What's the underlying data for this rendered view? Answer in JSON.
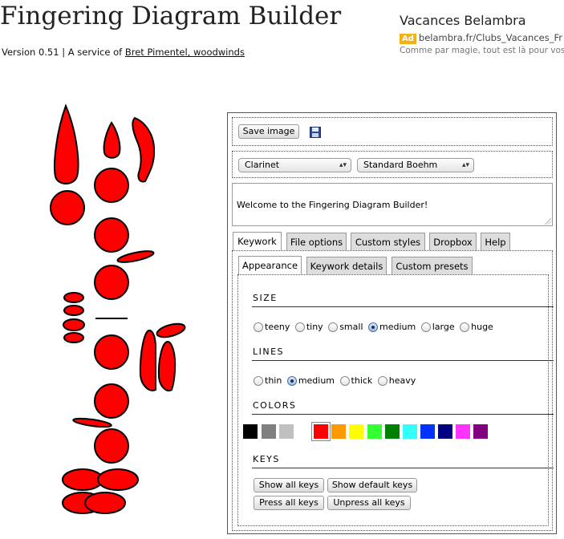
{
  "header": {
    "title": "Fingering Diagram Builder",
    "version_prefix": "Version 0.51 | A service of",
    "author_link": "Bret Pimentel, woodwinds"
  },
  "ad": {
    "title": "Vacances Belambra",
    "badge": "Ad",
    "url": "belambra.fr/Clubs_Vacances_Fr",
    "description": "Comme par magie, tout est là pour vos"
  },
  "toolbar": {
    "save_label": "Save image",
    "save_icon": "floppy-disk-icon"
  },
  "selects": {
    "instrument": "Clarinet",
    "system": "Standard Boehm"
  },
  "message": "Welcome to the Fingering Diagram Builder!",
  "tabs": [
    "Keywork",
    "File options",
    "Custom styles",
    "Dropbox",
    "Help"
  ],
  "active_tab": "Keywork",
  "subtabs": [
    "Appearance",
    "Keywork details",
    "Custom presets"
  ],
  "active_subtab": "Appearance",
  "size": {
    "label": "SIZE",
    "options": [
      "teeny",
      "tiny",
      "small",
      "medium",
      "large",
      "huge"
    ],
    "selected": "medium"
  },
  "lines": {
    "label": "LINES",
    "options": [
      "thin",
      "medium",
      "thick",
      "heavy"
    ],
    "selected": "medium"
  },
  "colors": {
    "label": "COLORS",
    "swatches": [
      "#000000",
      "#808080",
      "#c0c0c0",
      "#ff0000",
      "#ff9900",
      "#ffff00",
      "#33ff33",
      "#008000",
      "#33ffff",
      "#0033ff",
      "#000080",
      "#ff33ff",
      "#800080"
    ],
    "selected": "#ff0000"
  },
  "keys": {
    "label": "KEYS",
    "show_all": "Show all keys",
    "show_default": "Show default keys",
    "press_all": "Press all keys",
    "unpress_all": "Unpress all keys"
  },
  "diagram": {
    "fill": "#ff0000",
    "stroke": "#000000"
  }
}
